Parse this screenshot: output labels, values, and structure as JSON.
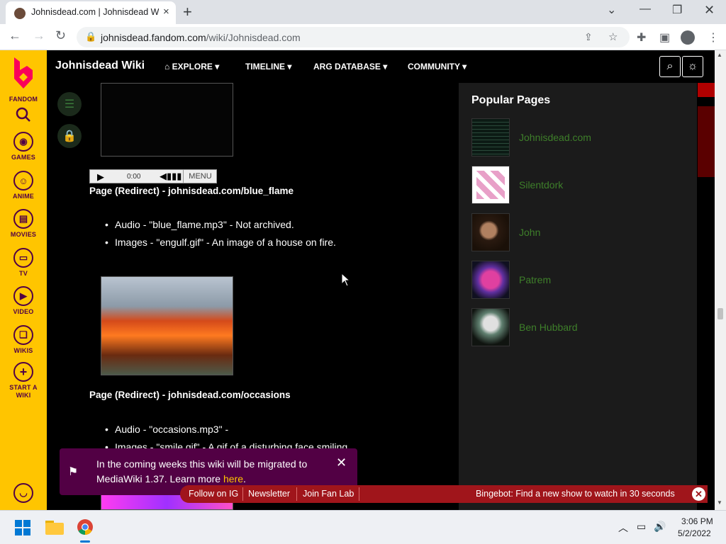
{
  "browser": {
    "tab_title": "Johnisdead.com | Johnisdead Wiki",
    "url_host": "johnisdead.fandom.com",
    "url_path": "/wiki/Johnisdead.com",
    "new_tab_icon": "+",
    "close_tab_icon": "×"
  },
  "fandom_rail": {
    "brand": "FANDOM",
    "items": [
      {
        "label": "GAMES",
        "icon": "gamepad-icon"
      },
      {
        "label": "ANIME",
        "icon": "anime-icon"
      },
      {
        "label": "MOVIES",
        "icon": "movies-icon"
      },
      {
        "label": "TV",
        "icon": "tv-icon"
      },
      {
        "label": "VIDEO",
        "icon": "video-icon"
      },
      {
        "label": "WIKIS",
        "icon": "wikis-icon"
      }
    ],
    "start_wiki_line1": "START A",
    "start_wiki_line2": "WIKI"
  },
  "header": {
    "wiki_name": "Johnisdead Wiki",
    "nav": [
      "EXPLORE",
      "TIMELINE",
      "ARG DATABASE",
      "COMMUNITY"
    ]
  },
  "content": {
    "audio_time": "0:00",
    "audio_menu": "MENU",
    "section1_heading": "Page (Redirect) - johnisdead.com/blue_flame",
    "section1_bullets": [
      "Audio - \"blue_flame.mp3\" - Not archived.",
      "Images - \"engulf.gif\" - An image of a house on fire."
    ],
    "section2_heading": "Page (Redirect) - johnisdead.com/occasions",
    "section2_bullets": [
      "Audio - \"occasions.mp3\" -",
      "Images - \"smile.gif\" - A gif of a disturbing face smiling."
    ]
  },
  "popular_pages": {
    "title": "Popular Pages",
    "items": [
      "Johnisdead.com",
      "Silentdork",
      "John",
      "Patrem",
      "Ben Hubbard"
    ]
  },
  "notification": {
    "text": "In the coming weeks this wiki will be migrated to MediaWiki 1.37. Learn more ",
    "link": "here",
    "tail": "."
  },
  "bottom_bar": {
    "links": [
      "Follow on IG",
      "Newsletter",
      "Join Fan Lab"
    ],
    "bingebot": "Bingebot: Find a new show to watch in 30 seconds"
  },
  "taskbar": {
    "time": "3:06 PM",
    "date": "5/2/2022"
  },
  "colors": {
    "fandom_yellow": "#ffc500",
    "fandom_purple": "#520044",
    "link_green": "#3e7f2a",
    "bar_red": "#a0151b"
  }
}
